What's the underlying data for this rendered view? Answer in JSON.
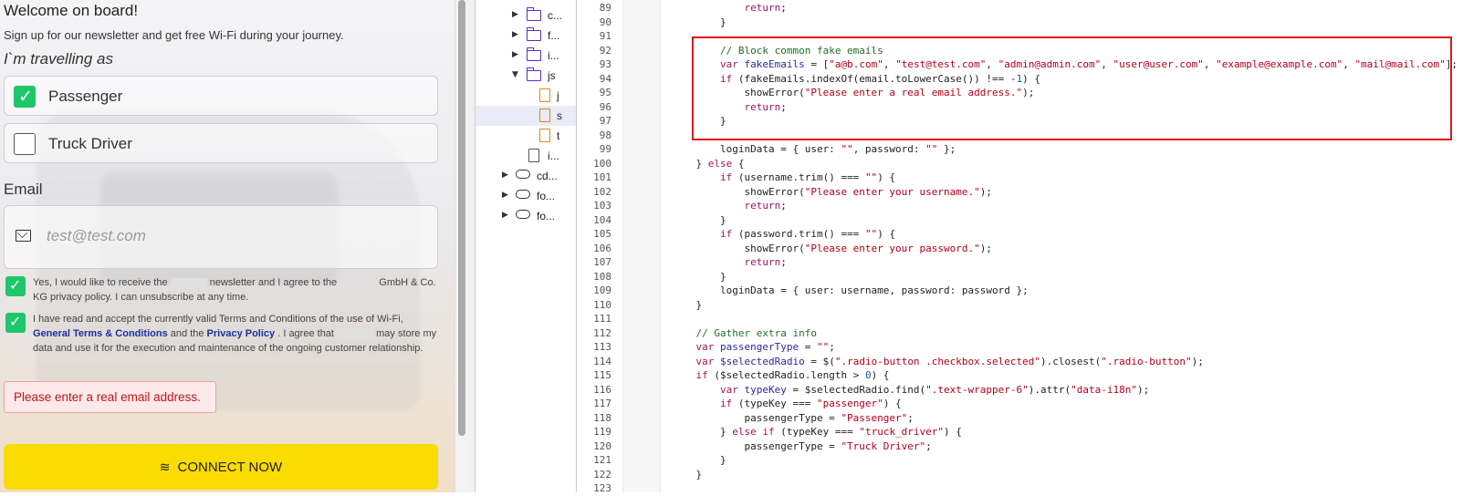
{
  "portal": {
    "title": "Welcome on board!",
    "subtitle": "Sign up for our newsletter and get free Wi-Fi during your journey.",
    "traveling_as": "I`m travelling as",
    "options": [
      {
        "label": "Passenger",
        "checked": true
      },
      {
        "label": "Truck Driver",
        "checked": false
      }
    ],
    "email_label": "Email",
    "email_placeholder": "test@test.com",
    "newsletter_text_1": "Yes, I would like to receive the",
    "newsletter_text_2": "newsletter and I agree to the",
    "newsletter_text_3": "GmbH & Co. KG privacy policy. I can unsubscribe at any time.",
    "terms_text_1": "I have read and accept the currently valid Terms and Conditions of the use of Wi-Fi,",
    "terms_link": "General Terms & Conditions",
    "terms_and": "and the",
    "privacy_link": "Privacy Policy",
    "terms_text_2": ". I agree that",
    "terms_text_3": "may store my data and use it for the execution and maintenance of the ongoing customer relationship.",
    "error": "Please enter a real email address.",
    "connect_label": "CONNECT NOW",
    "accent_color": "#f8dc04",
    "check_color": "#1ec76a"
  },
  "tree": {
    "items": [
      {
        "name": "c...",
        "icon": "folder-icon",
        "expanded": false
      },
      {
        "name": "f...",
        "icon": "folder-icon",
        "expanded": false
      },
      {
        "name": "i...",
        "icon": "folder-icon",
        "expanded": false
      },
      {
        "name": "js",
        "icon": "folder-icon",
        "expanded": true
      },
      {
        "name": "j",
        "icon": "js-file-icon"
      },
      {
        "name": "s",
        "icon": "js-file-icon",
        "selected": true
      },
      {
        "name": "t",
        "icon": "js-file-icon"
      },
      {
        "name": "i...",
        "icon": "file-icon"
      },
      {
        "name": "cd...",
        "icon": "cloud-icon",
        "expanded": false
      },
      {
        "name": "fo...",
        "icon": "cloud-icon",
        "expanded": false
      },
      {
        "name": "fo...",
        "icon": "cloud-icon",
        "expanded": false
      }
    ]
  },
  "editor": {
    "line_numbers": [
      "89",
      "90",
      "91",
      "92",
      "93",
      "94",
      "95",
      "96",
      "97",
      "98",
      "99",
      "100",
      "101",
      "102",
      "103",
      "104",
      "105",
      "106",
      "107",
      "108",
      "109",
      "110",
      "111",
      "112",
      "113",
      "114",
      "115",
      "116",
      "117",
      "118",
      "119",
      "120",
      "121",
      "122",
      "123"
    ],
    "lines": [
      "            return;",
      "        }",
      "",
      "        // Block common fake emails",
      "        var fakeEmails = [\"a@b.com\", \"test@test.com\", \"admin@admin.com\", \"user@user.com\", \"example@example.com\", \"mail@mail.com\"];",
      "        if (fakeEmails.indexOf(email.toLowerCase()) !== -1) {",
      "            showError(\"Please enter a real email address.\");",
      "            return;",
      "        }",
      "",
      "        loginData = { user: \"\", password: \"\" };",
      "    } else {",
      "        if (username.trim() === \"\") {",
      "            showError(\"Please enter your username.\");",
      "            return;",
      "        }",
      "        if (password.trim() === \"\") {",
      "            showError(\"Please enter your password.\");",
      "            return;",
      "        }",
      "        loginData = { user: username, password: password };",
      "    }",
      "",
      "    // Gather extra info",
      "    var passengerType = \"\";",
      "    var $selectedRadio = $(\".radio-button .checkbox.selected\").closest(\".radio-button\");",
      "    if ($selectedRadio.length > 0) {",
      "        var typeKey = $selectedRadio.find(\".text-wrapper-6\").attr(\"data-i18n\");",
      "        if (typeKey === \"passenger\") {",
      "            passengerType = \"Passenger\";",
      "        } else if (typeKey === \"truck_driver\") {",
      "            passengerType = \"Truck Driver\";",
      "        }",
      "    }",
      ""
    ],
    "highlight_color": "#e0141e"
  }
}
